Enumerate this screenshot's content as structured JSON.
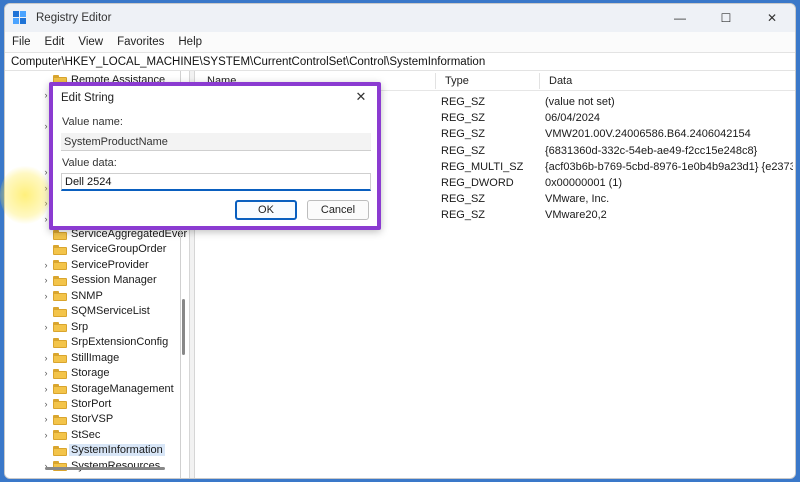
{
  "window": {
    "title": "Registry Editor",
    "controls": {
      "minimize": "—",
      "maximize": "☐",
      "close": "✕"
    }
  },
  "menu": [
    "File",
    "Edit",
    "View",
    "Favorites",
    "Help"
  ],
  "address": "Computer\\HKEY_LOCAL_MACHINE\\SYSTEM\\CurrentControlSet\\Control\\SystemInformation",
  "tree": [
    {
      "label": "Remote Assistance",
      "chevron": ""
    },
    {
      "label": "",
      "chevron": "›"
    },
    {
      "label": "",
      "chevron": ""
    },
    {
      "label": "",
      "chevron": "›"
    },
    {
      "label": "",
      "chevron": ""
    },
    {
      "label": "",
      "chevron": ""
    },
    {
      "label": "",
      "chevron": "›"
    },
    {
      "label": "",
      "chevron": "›"
    },
    {
      "label": "",
      "chevron": "›"
    },
    {
      "label": "",
      "chevron": "›"
    },
    {
      "label": "ServiceAggregatedEver",
      "chevron": ""
    },
    {
      "label": "ServiceGroupOrder",
      "chevron": ""
    },
    {
      "label": "ServiceProvider",
      "chevron": "›"
    },
    {
      "label": "Session Manager",
      "chevron": "›"
    },
    {
      "label": "SNMP",
      "chevron": "›"
    },
    {
      "label": "SQMServiceList",
      "chevron": ""
    },
    {
      "label": "Srp",
      "chevron": "›"
    },
    {
      "label": "SrpExtensionConfig",
      "chevron": ""
    },
    {
      "label": "StillImage",
      "chevron": "›"
    },
    {
      "label": "Storage",
      "chevron": "›"
    },
    {
      "label": "StorageManagement",
      "chevron": "›"
    },
    {
      "label": "StorPort",
      "chevron": "›"
    },
    {
      "label": "StorVSP",
      "chevron": "›"
    },
    {
      "label": "StSec",
      "chevron": "›"
    },
    {
      "label": "SystemInformation",
      "chevron": "",
      "selected": true
    },
    {
      "label": "SystemResources",
      "chevron": "›"
    }
  ],
  "list": {
    "headers": {
      "name": "Name",
      "type": "Type",
      "data": "Data"
    },
    "rows": [
      {
        "type": "REG_SZ",
        "data": "(value not set)"
      },
      {
        "type": "REG_SZ",
        "data": "06/04/2024"
      },
      {
        "type": "REG_SZ",
        "data": "VMW201.00V.24006586.B64.2406042154"
      },
      {
        "type": "REG_SZ",
        "data": "{6831360d-332c-54eb-ae49-f2cc15e248c8}"
      },
      {
        "type": "REG_MULTI_SZ",
        "data": "{acf03b6b-b769-5cbd-8976-1e0b4b9a23d1} {e2373..."
      },
      {
        "type": "REG_DWORD",
        "data": "0x00000001 (1)"
      },
      {
        "type": "REG_SZ",
        "data": "VMware, Inc."
      },
      {
        "type": "REG_SZ",
        "data": "VMware20,2"
      }
    ]
  },
  "dialog": {
    "title": "Edit String",
    "close": "✕",
    "value_name_label": "Value name:",
    "value_name": "SystemProductName",
    "value_data_label": "Value data:",
    "value_data": "Dell 2524",
    "ok": "OK",
    "cancel": "Cancel"
  },
  "colors": {
    "highlight_border": "#8b3bd1",
    "accent": "#0a5fbf",
    "folder": "#f3c44a"
  }
}
